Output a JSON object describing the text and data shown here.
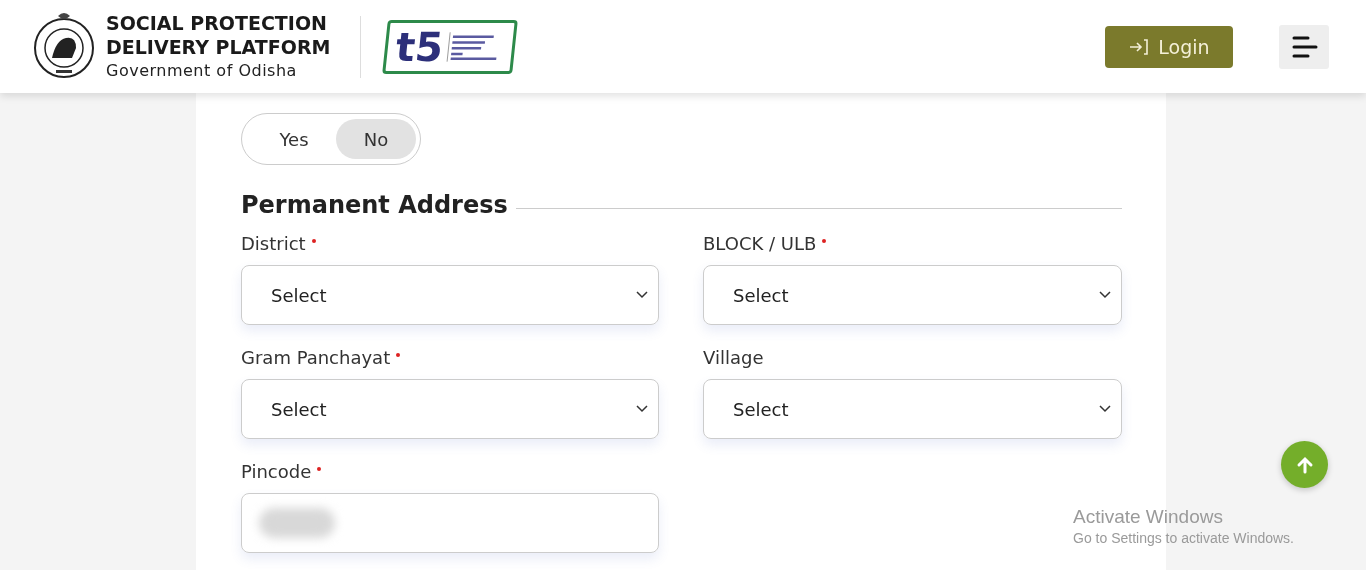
{
  "header": {
    "title_line_1": "SOCIAL PROTECTION",
    "title_line_2": "DELIVERY PLATFORM",
    "subtitle": "Government of Odisha",
    "partner_logo_text": "t5",
    "login_button": "Login"
  },
  "toggle": {
    "options": [
      {
        "label": "Yes",
        "selected": false
      },
      {
        "label": "No",
        "selected": true
      }
    ]
  },
  "section_title": "Permanent Address",
  "fields": [
    {
      "label": "District",
      "required": true,
      "kind": "select",
      "value": "Select"
    },
    {
      "label": "BLOCK / ULB",
      "required": true,
      "kind": "select",
      "value": "Select"
    },
    {
      "label": "Gram Panchayat",
      "required": true,
      "kind": "select",
      "value": "Select"
    },
    {
      "label": "Village",
      "required": false,
      "kind": "select",
      "value": "Select"
    },
    {
      "label": "Pincode",
      "required": true,
      "kind": "text",
      "redacted": true
    }
  ],
  "os_notice": {
    "title": "Activate Windows",
    "message": "Go to Settings to activate Windows."
  }
}
